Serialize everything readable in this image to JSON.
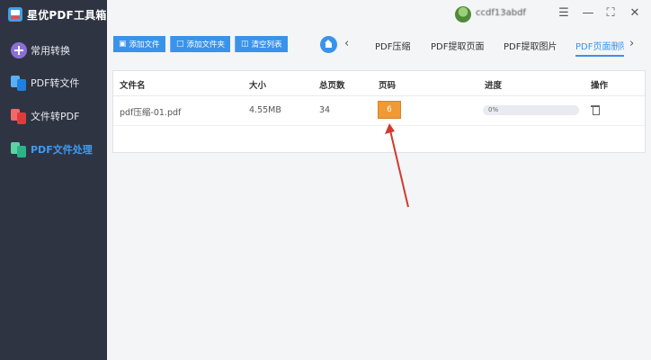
{
  "app": {
    "title": "星优PDF工具箱"
  },
  "sidebar": {
    "items": [
      {
        "label": "常用转换",
        "icon": "grid-icon",
        "active": false
      },
      {
        "label": "PDF转文件",
        "icon": "pdf-to-file-icon",
        "active": false
      },
      {
        "label": "文件转PDF",
        "icon": "file-to-pdf-icon",
        "active": false
      },
      {
        "label": "PDF文件处理",
        "icon": "pdf-process-icon",
        "active": true
      }
    ]
  },
  "header": {
    "user_id": "ccdf13abdf"
  },
  "toolbar": {
    "add_file": "添加文件",
    "add_folder": "添加文件夹",
    "clear_list": "清空列表"
  },
  "tabs": {
    "items": [
      "PDF压缩",
      "PDF提取页面",
      "PDF提取图片",
      "PDF页面删除"
    ],
    "active_index": 3
  },
  "table": {
    "headers": [
      "文件名",
      "大小",
      "总页数",
      "页码",
      "进度",
      "操作"
    ],
    "rows": [
      {
        "filename": "pdf压缩-01.pdf",
        "size": "4.55MB",
        "total_pages": "34",
        "page_num": "6",
        "progress": "0%"
      }
    ]
  },
  "colors": {
    "accent": "#3a93eb",
    "badge": "#ef9a34",
    "sidebar_bg": "#2f3442",
    "arrow": "#d23a2e"
  }
}
